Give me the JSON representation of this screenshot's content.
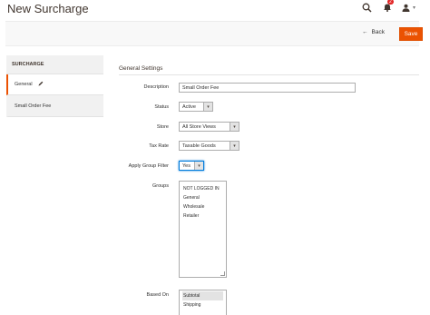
{
  "header": {
    "title": "New Surcharge",
    "notification_count": "2"
  },
  "toolbar": {
    "back_label": "Back",
    "save_label": "Save"
  },
  "sidebar": {
    "heading": "SURCHARGE",
    "items": [
      {
        "label": "General"
      },
      {
        "label": "Small Order Fee"
      }
    ]
  },
  "form": {
    "section_title": "General Settings",
    "description": {
      "label": "Description",
      "value": "Small Order Fee"
    },
    "status": {
      "label": "Status",
      "value": "Active"
    },
    "store": {
      "label": "Store",
      "value": "All Store Views"
    },
    "tax_rate": {
      "label": "Tax Rate",
      "value": "Taxable Goods"
    },
    "apply_group_filter": {
      "label": "Apply Group Filter",
      "value": "Yes"
    },
    "groups": {
      "label": "Groups",
      "options": [
        "NOT LOGGED IN",
        "General",
        "Wholesale",
        "Retailer"
      ]
    },
    "based_on": {
      "label": "Based On",
      "options": [
        "Subtotal",
        "Shipping"
      ]
    }
  },
  "colors": {
    "accent": "#eb5202",
    "focus": "#007bdb"
  },
  "icons": [
    "search-icon",
    "bell-icon",
    "user-icon",
    "back-arrow-icon",
    "pencil-icon",
    "chevron-down-icon"
  ]
}
